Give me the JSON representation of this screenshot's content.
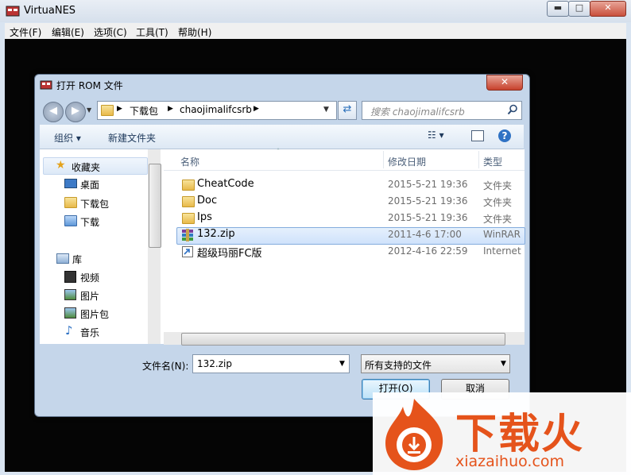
{
  "app": {
    "title": "VirtuaNES"
  },
  "window_controls": {
    "minimize": "▬",
    "maximize": "□",
    "close": "✕"
  },
  "menu": [
    "文件(F)",
    "编辑(E)",
    "选项(C)",
    "工具(T)",
    "帮助(H)"
  ],
  "dialog": {
    "title": "打开 ROM 文件",
    "close": "✕",
    "breadcrumb": [
      "下载包",
      "chaojimalifcsrb"
    ],
    "search_placeholder": "搜索 chaojimalifcsrb",
    "toolbar": {
      "organize": "组织 ▾",
      "new_folder": "新建文件夹"
    },
    "nav": {
      "favorites": "收藏夹",
      "desktop": "桌面",
      "downloads_pkg": "下载包",
      "downloads": "下载",
      "libraries": "库",
      "videos": "视频",
      "pictures": "图片",
      "pictures_pkg": "图片包",
      "music": "音乐"
    },
    "columns": {
      "name": "名称",
      "date": "修改日期",
      "type": "类型"
    },
    "files": [
      {
        "name": "CheatCode",
        "date": "2015-5-21 19:36",
        "type": "文件夹",
        "icon": "folder-icon"
      },
      {
        "name": "Doc",
        "date": "2015-5-21 19:36",
        "type": "文件夹",
        "icon": "folder-icon"
      },
      {
        "name": "Ips",
        "date": "2015-5-21 19:36",
        "type": "文件夹",
        "icon": "folder-icon"
      },
      {
        "name": "132.zip",
        "date": "2011-4-6 17:00",
        "type": "WinRAR",
        "icon": "winrar-icon"
      },
      {
        "name": "超级玛丽FC版",
        "date": "2012-4-16 22:59",
        "type": "Internet",
        "icon": "shortcut-icon"
      }
    ],
    "selected_file_index": 3,
    "filename_label": "文件名(N):",
    "filename_value": "132.zip",
    "filetype_value": "所有支持的文件",
    "open_button": "打开(O)",
    "cancel_button": "取消"
  },
  "watermark": {
    "cn": "下载火",
    "en": "xiazaihuo.com"
  },
  "colors": {
    "accent": "#e5531b",
    "selection": "#cfe2fb"
  }
}
